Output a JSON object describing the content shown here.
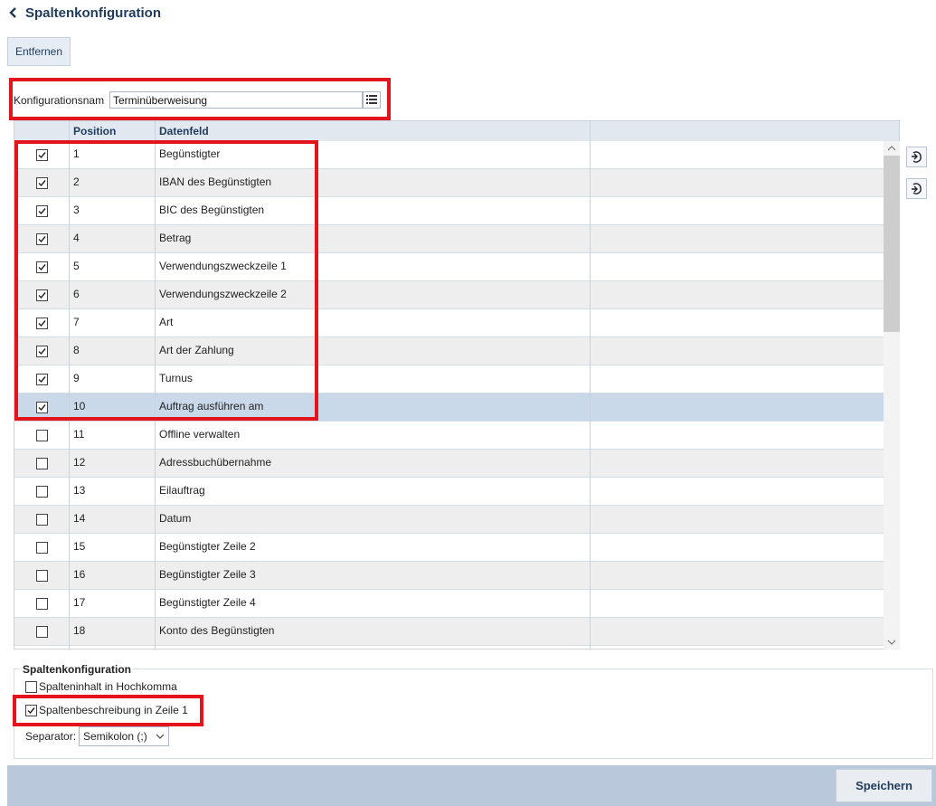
{
  "header": {
    "title": "Spaltenkonfiguration",
    "back_icon": "chevron-left-icon"
  },
  "toolbar": {
    "remove_label": "Entfernen"
  },
  "config": {
    "name_label": "Konfigurationsnam",
    "name_value": "Terminüberweisung",
    "list_icon": "list-icon"
  },
  "table": {
    "headers": [
      "Position",
      "Datenfeld"
    ],
    "rows": [
      {
        "checked": true,
        "position": "1",
        "field": "Begünstigter"
      },
      {
        "checked": true,
        "position": "2",
        "field": "IBAN des Begünstigten"
      },
      {
        "checked": true,
        "position": "3",
        "field": "BIC des Begünstigten"
      },
      {
        "checked": true,
        "position": "4",
        "field": "Betrag"
      },
      {
        "checked": true,
        "position": "5",
        "field": "Verwendungszweckzeile 1"
      },
      {
        "checked": true,
        "position": "6",
        "field": "Verwendungszweckzeile 2"
      },
      {
        "checked": true,
        "position": "7",
        "field": "Art"
      },
      {
        "checked": true,
        "position": "8",
        "field": "Art der Zahlung"
      },
      {
        "checked": true,
        "position": "9",
        "field": "Turnus"
      },
      {
        "checked": true,
        "position": "10",
        "field": "Auftrag ausführen am",
        "selected": true
      },
      {
        "checked": false,
        "position": "11",
        "field": "Offline verwalten"
      },
      {
        "checked": false,
        "position": "12",
        "field": "Adressbuchübernahme"
      },
      {
        "checked": false,
        "position": "13",
        "field": "Eilauftrag"
      },
      {
        "checked": false,
        "position": "14",
        "field": "Datum"
      },
      {
        "checked": false,
        "position": "15",
        "field": "Begünstigter Zeile 2"
      },
      {
        "checked": false,
        "position": "16",
        "field": "Begünstigter Zeile 3"
      },
      {
        "checked": false,
        "position": "17",
        "field": "Begünstigter Zeile 4"
      },
      {
        "checked": false,
        "position": "18",
        "field": "Konto des Begünstigten"
      }
    ]
  },
  "move_buttons": {
    "up_icon": "move-up-icon",
    "down_icon": "move-down-icon"
  },
  "column_config": {
    "legend": "Spaltenkonfiguration",
    "quote_label": "Spalteninhalt in Hochkomma",
    "quote_checked": false,
    "header_row_label": "Spaltenbeschreibung in Zeile 1",
    "header_row_checked": true,
    "separator_label": "Separator:",
    "separator_value": "Semikolon (;)"
  },
  "footer": {
    "save_label": "Speichern"
  },
  "colors": {
    "highlight": "#e3141b",
    "title": "#1f3a5c",
    "footer": "#b9c8da",
    "selected_row": "#c9d9ea"
  }
}
